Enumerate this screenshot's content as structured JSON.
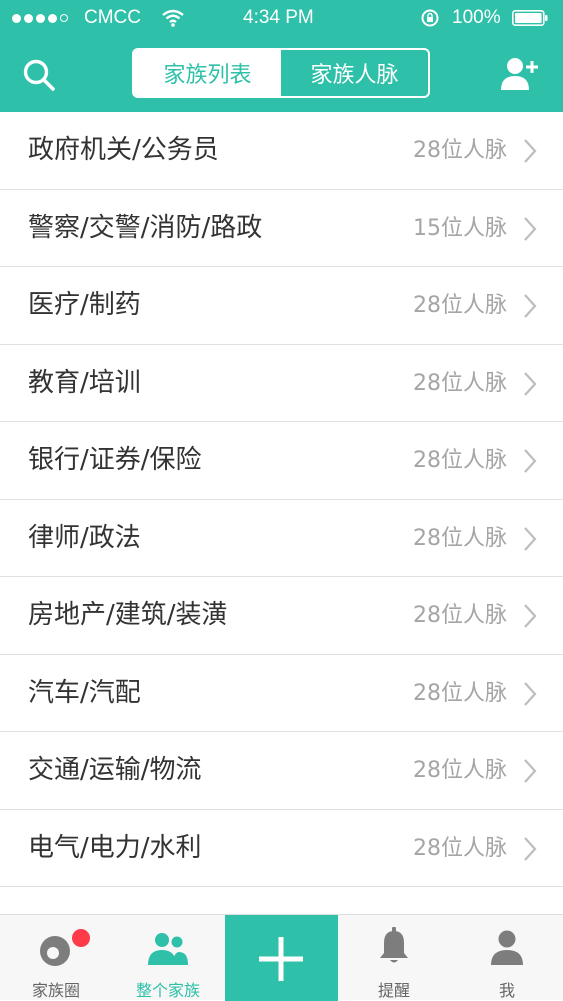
{
  "status_bar": {
    "carrier": "CMCC",
    "time": "4:34 PM",
    "battery": "100%"
  },
  "header": {
    "tabs": [
      {
        "label": "家族列表",
        "active": true
      },
      {
        "label": "家族人脉",
        "active": false
      }
    ]
  },
  "categories": [
    {
      "label": "政府机关/公务员",
      "count": "28位人脉"
    },
    {
      "label": "警察/交警/消防/路政",
      "count": "15位人脉"
    },
    {
      "label": "医疗/制药",
      "count": "28位人脉"
    },
    {
      "label": "教育/培训",
      "count": "28位人脉"
    },
    {
      "label": "银行/证券/保险",
      "count": "28位人脉"
    },
    {
      "label": "律师/政法",
      "count": "28位人脉"
    },
    {
      "label": "房地产/建筑/装潢",
      "count": "28位人脉"
    },
    {
      "label": "汽车/汽配",
      "count": "28位人脉"
    },
    {
      "label": "交通/运输/物流",
      "count": "28位人脉"
    },
    {
      "label": "电气/电力/水利",
      "count": "28位人脉"
    }
  ],
  "tabbar": {
    "items": [
      {
        "label": "家族圈",
        "icon": "family-circle-icon"
      },
      {
        "label": "整个家族",
        "icon": "whole-family-icon",
        "active": true
      },
      {
        "label": "",
        "icon": "plus-icon"
      },
      {
        "label": "提醒",
        "icon": "bell-icon"
      },
      {
        "label": "我",
        "icon": "person-icon"
      }
    ]
  },
  "colors": {
    "brand": "#2ec0a8",
    "badge": "#ff3b4a",
    "text": "#333333",
    "muted": "#a5a5a5"
  }
}
